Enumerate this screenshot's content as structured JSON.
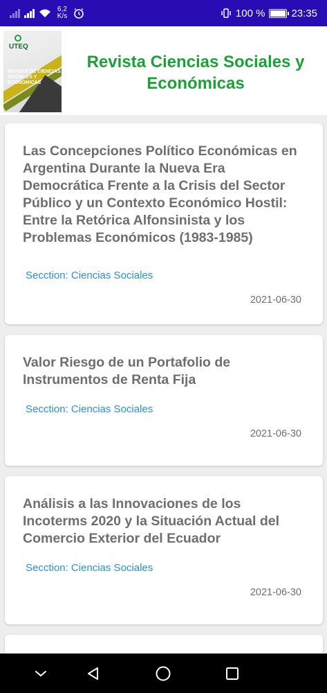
{
  "status_bar": {
    "speed_value": "6,2",
    "speed_unit": "K/s",
    "battery_percent": "100 %",
    "battery_level": 1.0,
    "time": "23:35",
    "icons": [
      "signal-icon",
      "signal-icon",
      "wifi-icon",
      "alarm-icon",
      "vibrate-icon",
      "battery-icon"
    ]
  },
  "header": {
    "title": "Revista Ciencias Sociales y Económicas",
    "cover_logo_text": "UTEQ",
    "cover_title_text": "REVISTA DE CIENCIAS SOCIALES Y ECONÓMICAS"
  },
  "articles": [
    {
      "title": "Las Concepciones Político Económicas en Argentina Durante la Nueva Era Democrática Frente a la Crisis del Sector Público y un Contexto Económico Hostil: Entre la Retórica Alfonsinista y los Problemas Económicos (1983-1985)",
      "section": "Secction: Ciencias Sociales",
      "date": "2021-06-30"
    },
    {
      "title": "Valor Riesgo de un Portafolio de Instrumentos de Renta Fija",
      "section": "Secction: Ciencias Sociales",
      "date": "2021-06-30"
    },
    {
      "title": "Análisis a las Innovaciones de los Incoterms 2020 y la Situación Actual del Comercio Exterior del Ecuador",
      "section": "Secction: Ciencias Sociales",
      "date": "2021-06-30"
    }
  ],
  "nav_bar": {
    "buttons": [
      "chevron-down-icon",
      "back-icon",
      "home-icon",
      "recents-icon"
    ]
  },
  "colors": {
    "status_bar": "#2a0cb5",
    "title_green": "#1aa238",
    "section_blue": "#2a8fd6",
    "text_gray": "#6e6e6e",
    "background": "#eeeeee"
  }
}
